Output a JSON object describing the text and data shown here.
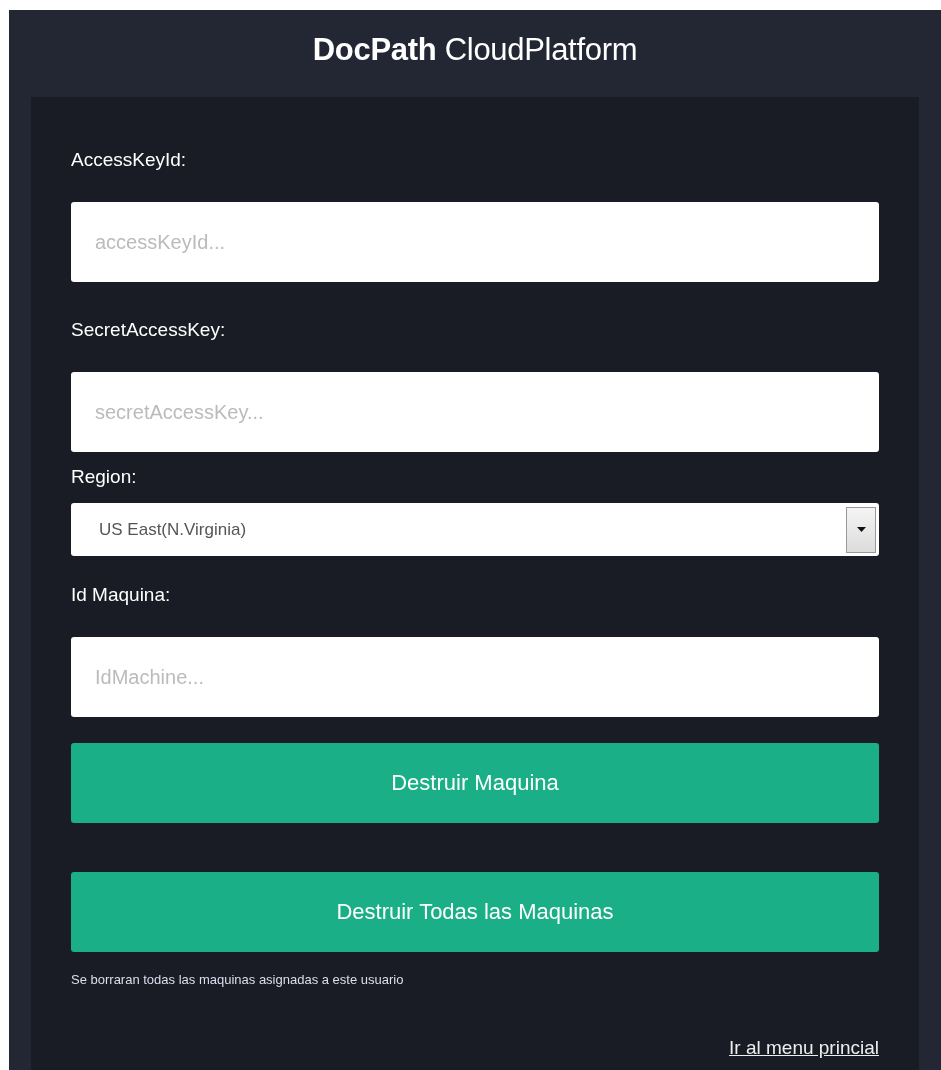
{
  "header": {
    "title": "**DocPath** CloudPlatform"
  },
  "fields": [
    {
      "kind": "text",
      "label": "AccessKeyId:",
      "placeholder": "accessKeyId..."
    },
    {
      "kind": "text",
      "label": "SecretAccessKey:",
      "placeholder": "secretAccessKey..."
    },
    {
      "kind": "select",
      "label": "Region:",
      "value": "US East(N.Virginia)"
    },
    {
      "kind": "text",
      "label": "Id Maquina:",
      "placeholder": "IdMachine..."
    }
  ],
  "buttons": [
    "Destruir Maquina",
    "Destruir Todas las Maquinas"
  ],
  "note": "Se borraran todas las maquinas asignadas a este usuario",
  "link": "Ir al menu princial"
}
